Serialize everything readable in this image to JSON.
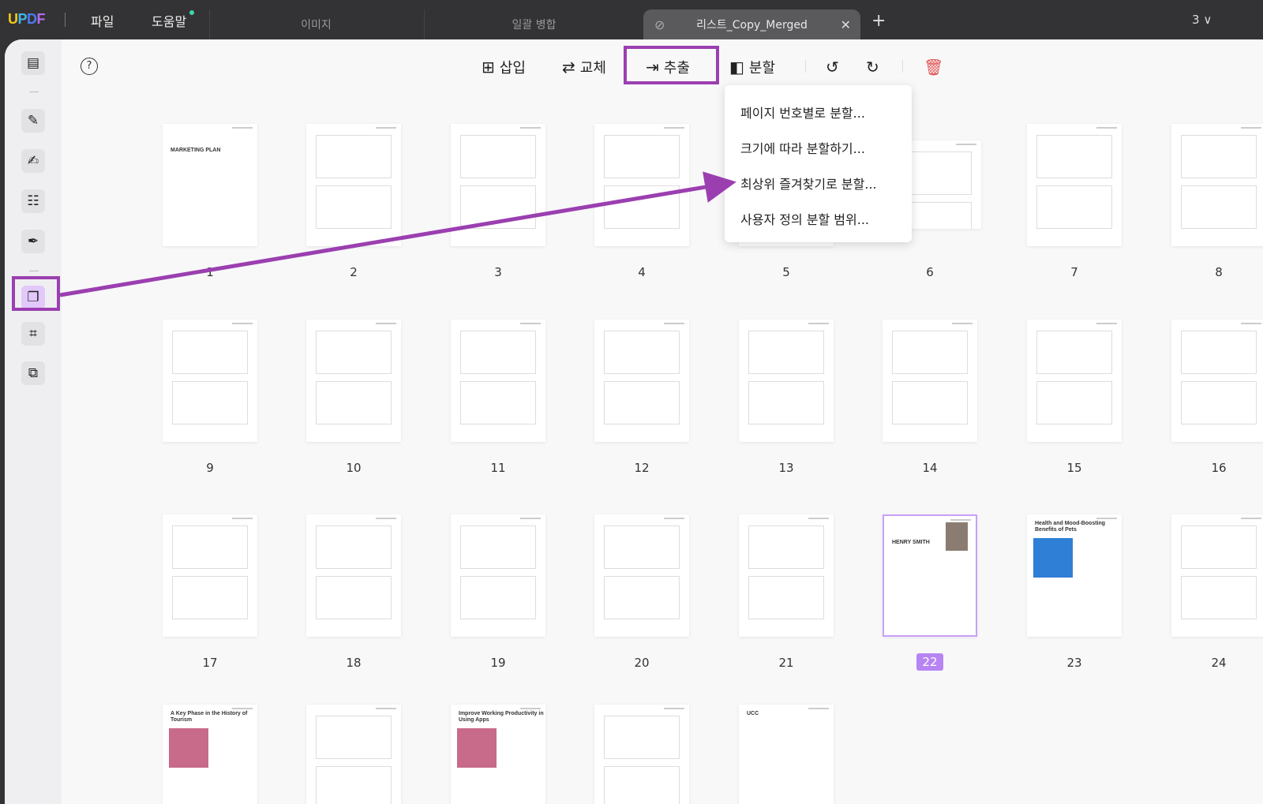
{
  "app": {
    "logo": "UPDF",
    "menus": [
      "파일",
      "도움말"
    ]
  },
  "tabs": [
    {
      "label": "이미지"
    },
    {
      "label": "일괄 병합"
    },
    {
      "label": "리스트_Copy_Merged",
      "active": true
    }
  ],
  "window_count": "3",
  "toolbar": {
    "insert": "삽입",
    "replace": "교체",
    "extract": "추출",
    "split": "분할"
  },
  "split_menu": [
    "페이지 번호별로 분할...",
    "크기에 따라 분할하기...",
    "최상위 즐겨찾기로 분할...",
    "사용자 정의 분할 범위..."
  ],
  "pages": [
    "1",
    "2",
    "3",
    "4",
    "5",
    "6",
    "7",
    "8",
    "9",
    "10",
    "11",
    "12",
    "13",
    "14",
    "15",
    "16",
    "17",
    "18",
    "19",
    "20",
    "21",
    "22",
    "23",
    "24"
  ],
  "selected_page": "22",
  "thumb_titles": {
    "p1": "MARKETING PLAN",
    "p22": "HENRY SMITH",
    "p23": "Health and Mood-Boosting Benefits of Pets",
    "p25": "A Key Phase in the History of Tourism",
    "p27": "Improve Working Productivity in Using Apps",
    "p29": "UCC"
  },
  "colors": {
    "accent": "#b784f4",
    "annotation": "#9b3fb0",
    "delete": "#e55353"
  }
}
